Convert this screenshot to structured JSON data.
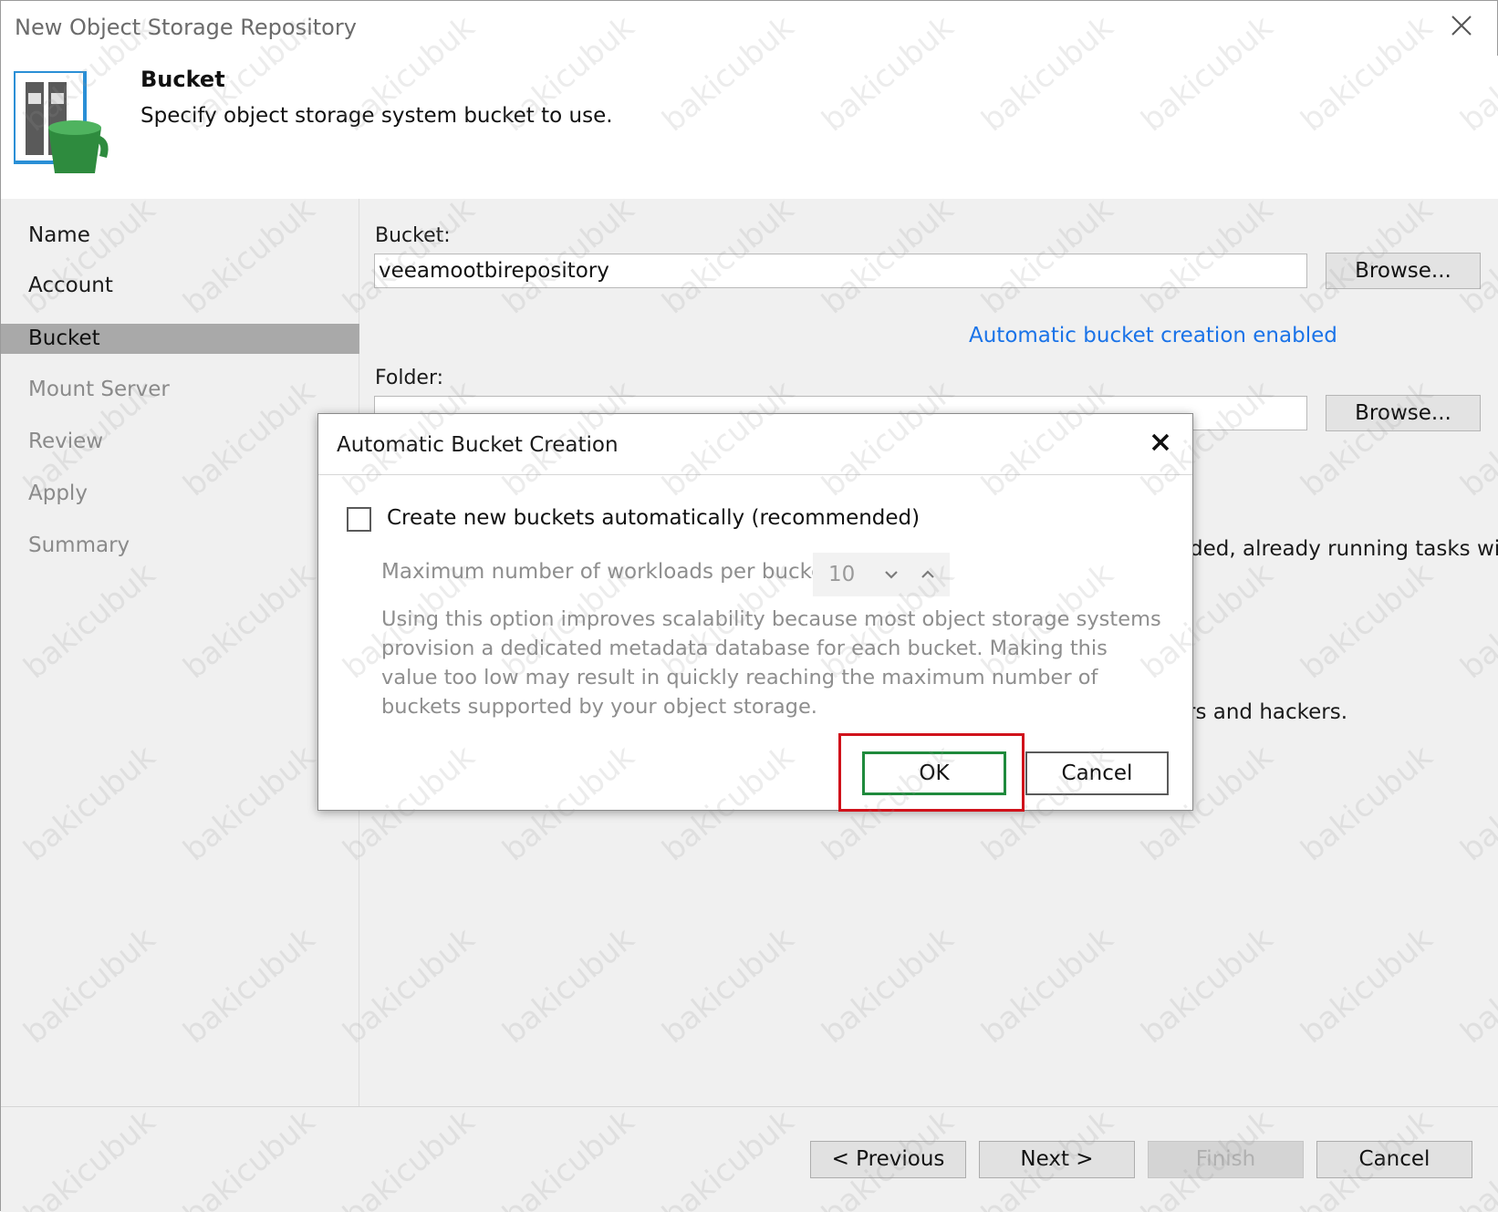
{
  "window": {
    "title": "New Object Storage Repository",
    "close_icon": "close-icon"
  },
  "header": {
    "title": "Bucket",
    "subtitle": "Specify object storage system bucket to use.",
    "icon": "object-storage-bucket-icon"
  },
  "sidebar": {
    "steps": [
      {
        "label": "Name"
      },
      {
        "label": "Account"
      },
      {
        "label": "Bucket"
      },
      {
        "label": "Mount Server"
      },
      {
        "label": "Review"
      },
      {
        "label": "Apply"
      },
      {
        "label": "Summary"
      }
    ],
    "active": "Bucket"
  },
  "main": {
    "bucket_label": "Bucket:",
    "bucket_value": "veeamootbirepository",
    "browse_label": "Browse...",
    "auto_bucket_link": "Automatic bucket creation enabled",
    "folder_label": "Folder:",
    "folder_value": "",
    "folder_browse_label": "Browse...",
    "partial_text_1": "ded, already running tasks will",
    "partial_text_2": "rs and hackers."
  },
  "modal": {
    "title": "Automatic Bucket Creation",
    "checkbox_label": "Create new buckets automatically (recommended)",
    "checkbox_checked": false,
    "max_workloads_label": "Maximum number of workloads per bucket:",
    "max_workloads_value": "10",
    "description": "Using this option improves scalability because most object storage systems provision a dedicated metadata database for each bucket. Making this value too low may result in quickly reaching the maximum number of buckets supported by your object storage.",
    "ok_label": "OK",
    "cancel_label": "Cancel"
  },
  "footer": {
    "previous_label": "< Previous",
    "next_label": "Next >",
    "finish_label": "Finish",
    "cancel_label": "Cancel"
  },
  "watermark": "bakicubuk",
  "colors": {
    "link": "#1a73e8",
    "highlight": "#d0121b",
    "ok_border": "#1f8a3c",
    "active_step": "#a9a9a9"
  }
}
